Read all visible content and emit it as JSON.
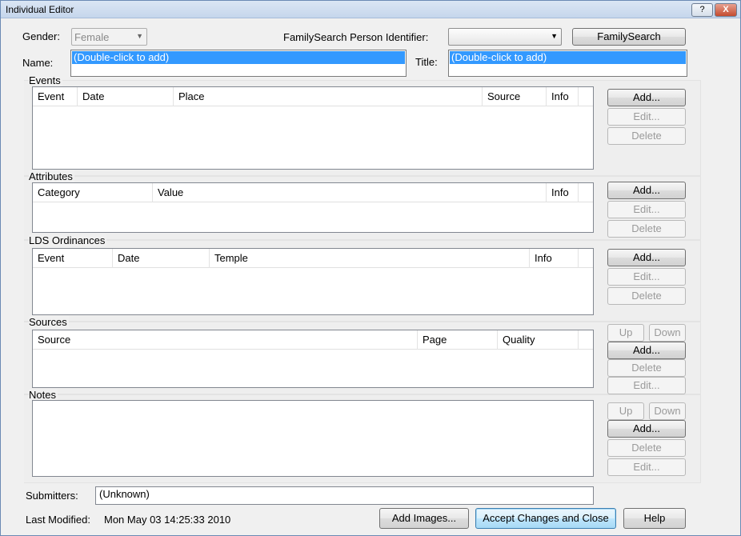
{
  "window": {
    "title": "Individual Editor",
    "help_label": "?",
    "close_label": "X"
  },
  "gender": {
    "label": "Gender:",
    "value": "Female",
    "arrow": "▼"
  },
  "familysearch": {
    "label": "FamilySearch Person Identifier:",
    "value": "",
    "arrow": "▼",
    "button": "FamilySearch"
  },
  "name": {
    "label": "Name:",
    "value": "(Double-click to add)"
  },
  "title_field": {
    "label": "Title:",
    "value": "(Double-click to add)"
  },
  "events": {
    "label": "Events",
    "columns": [
      "Event",
      "Date",
      "Place",
      "Source",
      "Info"
    ],
    "add": "Add...",
    "edit": "Edit...",
    "delete": "Delete"
  },
  "attributes": {
    "label": "Attributes",
    "columns": [
      "Category",
      "Value",
      "Info"
    ],
    "add": "Add...",
    "edit": "Edit...",
    "delete": "Delete"
  },
  "lds": {
    "label": "LDS Ordinances",
    "columns": [
      "Event",
      "Date",
      "Temple",
      "Info"
    ],
    "add": "Add...",
    "edit": "Edit...",
    "delete": "Delete"
  },
  "sources": {
    "label": "Sources",
    "columns": [
      "Source",
      "Page",
      "Quality"
    ],
    "up": "Up",
    "down": "Down",
    "add": "Add...",
    "delete": "Delete",
    "edit": "Edit..."
  },
  "notes": {
    "label": "Notes",
    "up": "Up",
    "down": "Down",
    "add": "Add...",
    "delete": "Delete",
    "edit": "Edit..."
  },
  "submitters": {
    "label": "Submitters:",
    "value": "(Unknown)"
  },
  "last_modified": {
    "label": "Last Modified:",
    "value": "Mon May 03 14:25:33 2010"
  },
  "footer": {
    "add_images": "Add Images...",
    "accept": "Accept Changes and Close",
    "help": "Help"
  }
}
